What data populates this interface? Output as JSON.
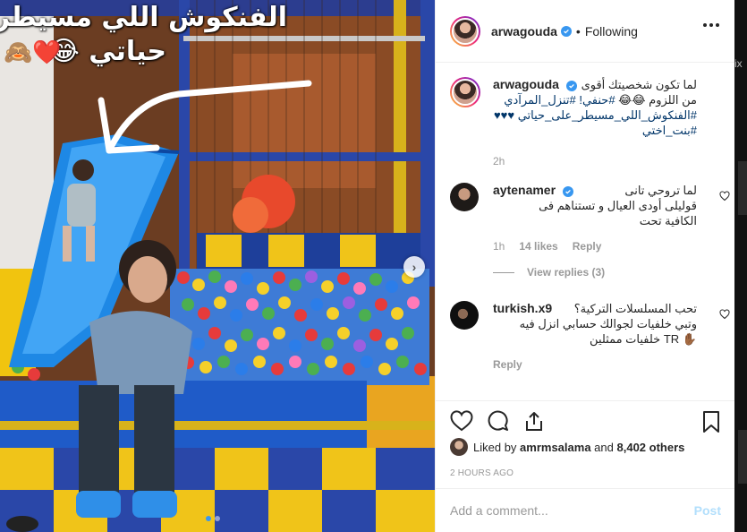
{
  "post_image": {
    "caption_line1": "الفنكوش اللي مسيطر على",
    "caption_line2": "حياتي 😂",
    "caption_emojis": "🙈❤️"
  },
  "carousel": {
    "total": 2,
    "active": 1
  },
  "header": {
    "username": "arwagouda",
    "separator": "•",
    "follow_state": "Following"
  },
  "caption": {
    "username": "arwagouda",
    "line1": "لما تكون شخصيتك أقوى",
    "line2_prefix": "من اللزوم 😂😂 ",
    "line2_tags": "#حنفي! #تنزل_المرآدي",
    "line3": "#الفنكوش_اللي_مسيطر_على_حياتي ♥♥♥",
    "line4": "#بنت_اختي",
    "time": "2h"
  },
  "comments": [
    {
      "username": "aytenamer",
      "verified": true,
      "lines": [
        "لما تروحي تانى",
        "قوليلى أودى العيال و تستناهم فى",
        "الكافية تحت"
      ],
      "time": "1h",
      "likes": "14 likes",
      "reply": "Reply",
      "view_replies": "View replies (3)"
    },
    {
      "username": "turkish.x9",
      "verified": false,
      "lines": [
        "تحب المسلسلات التركية؟",
        "وتبي خلفيات لجوالك حسابي انزل فيه",
        "✋🏾 TR خلفيات ممثلين"
      ],
      "time": "",
      "reply": "Reply"
    }
  ],
  "likes": {
    "prefix": "Liked by",
    "user": "amrmsalama",
    "middle": "and",
    "count": "8,402 others"
  },
  "timestamp": "2 HOURS AGO",
  "add_comment": {
    "placeholder": "Add a comment...",
    "post_label": "Post"
  },
  "colors": {
    "accent": "#3897f0",
    "hashtag": "#003569",
    "muted": "#999999"
  },
  "icons": [
    "verified-badge-icon",
    "more-options-icon",
    "heart-icon",
    "comment-icon",
    "share-icon",
    "bookmark-icon",
    "next-arrow-icon"
  ]
}
